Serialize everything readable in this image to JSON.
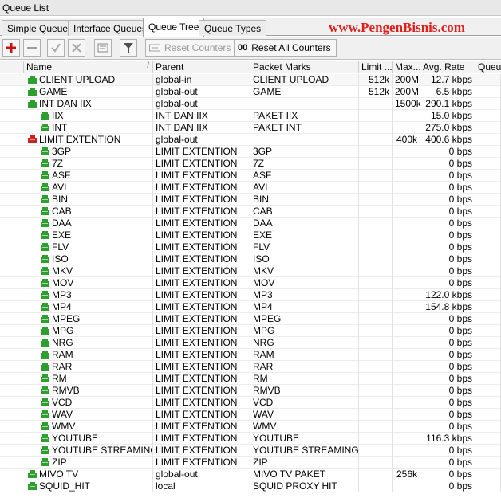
{
  "window": {
    "title": "Queue List"
  },
  "tabs": [
    {
      "label": "Simple Queues",
      "active": false
    },
    {
      "label": "Interface Queues",
      "active": false
    },
    {
      "label": "Queue Tree",
      "active": true
    },
    {
      "label": "Queue Types",
      "active": false
    }
  ],
  "watermark": "www.PengenBisnis.com",
  "toolbar": {
    "reset_counters": "Reset Counters",
    "reset_all_prefix": "00",
    "reset_all_counters": "Reset All Counters"
  },
  "columns": {
    "name": "Name",
    "parent": "Parent",
    "packet_marks": "Packet Marks",
    "limit_at": "Limit ...",
    "max_limit": "Max...",
    "avg_rate": "Avg. Rate",
    "queued": "Queue"
  },
  "colors": {
    "enabled_icon": "#2e9e2e",
    "disabled_icon": "#d02020",
    "brand": "#e0201c"
  },
  "rows": [
    {
      "indent": 0,
      "status": "green",
      "name": "CLIENT UPLOAD",
      "parent": "global-in",
      "packet_marks": "CLIENT UPLOAD",
      "limit_at": "512k",
      "max_limit": "200M",
      "avg_rate": "12.7 kbps"
    },
    {
      "indent": 0,
      "status": "green",
      "name": "GAME",
      "parent": "global-out",
      "packet_marks": "GAME",
      "limit_at": "512k",
      "max_limit": "200M",
      "avg_rate": "6.5 kbps"
    },
    {
      "indent": 0,
      "status": "green",
      "name": "INT DAN IIX",
      "parent": "global-out",
      "packet_marks": "",
      "limit_at": "",
      "max_limit": "1500k",
      "avg_rate": "290.1 kbps"
    },
    {
      "indent": 1,
      "status": "green",
      "name": "IIX",
      "parent": "INT DAN IIX",
      "packet_marks": "PAKET IIX",
      "limit_at": "",
      "max_limit": "",
      "avg_rate": "15.0 kbps"
    },
    {
      "indent": 1,
      "status": "green",
      "name": "INT",
      "parent": "INT DAN IIX",
      "packet_marks": "PAKET INT",
      "limit_at": "",
      "max_limit": "",
      "avg_rate": "275.0 kbps"
    },
    {
      "indent": 0,
      "status": "red",
      "name": "LIMIT EXTENTION",
      "parent": "global-out",
      "packet_marks": "",
      "limit_at": "",
      "max_limit": "400k",
      "avg_rate": "400.6 kbps"
    },
    {
      "indent": 1,
      "status": "green",
      "name": "3GP",
      "parent": "LIMIT EXTENTION",
      "packet_marks": "3GP",
      "limit_at": "",
      "max_limit": "",
      "avg_rate": "0 bps"
    },
    {
      "indent": 1,
      "status": "green",
      "name": "7Z",
      "parent": "LIMIT EXTENTION",
      "packet_marks": "7Z",
      "limit_at": "",
      "max_limit": "",
      "avg_rate": "0 bps"
    },
    {
      "indent": 1,
      "status": "green",
      "name": "ASF",
      "parent": "LIMIT EXTENTION",
      "packet_marks": "ASF",
      "limit_at": "",
      "max_limit": "",
      "avg_rate": "0 bps"
    },
    {
      "indent": 1,
      "status": "green",
      "name": "AVI",
      "parent": "LIMIT EXTENTION",
      "packet_marks": "AVI",
      "limit_at": "",
      "max_limit": "",
      "avg_rate": "0 bps"
    },
    {
      "indent": 1,
      "status": "green",
      "name": "BIN",
      "parent": "LIMIT EXTENTION",
      "packet_marks": "BIN",
      "limit_at": "",
      "max_limit": "",
      "avg_rate": "0 bps"
    },
    {
      "indent": 1,
      "status": "green",
      "name": "CAB",
      "parent": "LIMIT EXTENTION",
      "packet_marks": "CAB",
      "limit_at": "",
      "max_limit": "",
      "avg_rate": "0 bps"
    },
    {
      "indent": 1,
      "status": "green",
      "name": "DAA",
      "parent": "LIMIT EXTENTION",
      "packet_marks": "DAA",
      "limit_at": "",
      "max_limit": "",
      "avg_rate": "0 bps"
    },
    {
      "indent": 1,
      "status": "green",
      "name": "EXE",
      "parent": "LIMIT EXTENTION",
      "packet_marks": "EXE",
      "limit_at": "",
      "max_limit": "",
      "avg_rate": "0 bps"
    },
    {
      "indent": 1,
      "status": "green",
      "name": "FLV",
      "parent": "LIMIT EXTENTION",
      "packet_marks": "FLV",
      "limit_at": "",
      "max_limit": "",
      "avg_rate": "0 bps"
    },
    {
      "indent": 1,
      "status": "green",
      "name": "ISO",
      "parent": "LIMIT EXTENTION",
      "packet_marks": "ISO",
      "limit_at": "",
      "max_limit": "",
      "avg_rate": "0 bps"
    },
    {
      "indent": 1,
      "status": "green",
      "name": "MKV",
      "parent": "LIMIT EXTENTION",
      "packet_marks": "MKV",
      "limit_at": "",
      "max_limit": "",
      "avg_rate": "0 bps"
    },
    {
      "indent": 1,
      "status": "green",
      "name": "MOV",
      "parent": "LIMIT EXTENTION",
      "packet_marks": "MOV",
      "limit_at": "",
      "max_limit": "",
      "avg_rate": "0 bps"
    },
    {
      "indent": 1,
      "status": "green",
      "name": "MP3",
      "parent": "LIMIT EXTENTION",
      "packet_marks": "MP3",
      "limit_at": "",
      "max_limit": "",
      "avg_rate": "122.0 kbps"
    },
    {
      "indent": 1,
      "status": "green",
      "name": "MP4",
      "parent": "LIMIT EXTENTION",
      "packet_marks": "MP4",
      "limit_at": "",
      "max_limit": "",
      "avg_rate": "154.8 kbps"
    },
    {
      "indent": 1,
      "status": "green",
      "name": "MPEG",
      "parent": "LIMIT EXTENTION",
      "packet_marks": "MPEG",
      "limit_at": "",
      "max_limit": "",
      "avg_rate": "0 bps"
    },
    {
      "indent": 1,
      "status": "green",
      "name": "MPG",
      "parent": "LIMIT EXTENTION",
      "packet_marks": "MPG",
      "limit_at": "",
      "max_limit": "",
      "avg_rate": "0 bps"
    },
    {
      "indent": 1,
      "status": "green",
      "name": "NRG",
      "parent": "LIMIT EXTENTION",
      "packet_marks": "NRG",
      "limit_at": "",
      "max_limit": "",
      "avg_rate": "0 bps"
    },
    {
      "indent": 1,
      "status": "green",
      "name": "RAM",
      "parent": "LIMIT EXTENTION",
      "packet_marks": "RAM",
      "limit_at": "",
      "max_limit": "",
      "avg_rate": "0 bps"
    },
    {
      "indent": 1,
      "status": "green",
      "name": "RAR",
      "parent": "LIMIT EXTENTION",
      "packet_marks": "RAR",
      "limit_at": "",
      "max_limit": "",
      "avg_rate": "0 bps"
    },
    {
      "indent": 1,
      "status": "green",
      "name": "RM",
      "parent": "LIMIT EXTENTION",
      "packet_marks": "RM",
      "limit_at": "",
      "max_limit": "",
      "avg_rate": "0 bps"
    },
    {
      "indent": 1,
      "status": "green",
      "name": "RMVB",
      "parent": "LIMIT EXTENTION",
      "packet_marks": "RMVB",
      "limit_at": "",
      "max_limit": "",
      "avg_rate": "0 bps"
    },
    {
      "indent": 1,
      "status": "green",
      "name": "VCD",
      "parent": "LIMIT EXTENTION",
      "packet_marks": "VCD",
      "limit_at": "",
      "max_limit": "",
      "avg_rate": "0 bps"
    },
    {
      "indent": 1,
      "status": "green",
      "name": "WAV",
      "parent": "LIMIT EXTENTION",
      "packet_marks": "WAV",
      "limit_at": "",
      "max_limit": "",
      "avg_rate": "0 bps"
    },
    {
      "indent": 1,
      "status": "green",
      "name": "WMV",
      "parent": "LIMIT EXTENTION",
      "packet_marks": "WMV",
      "limit_at": "",
      "max_limit": "",
      "avg_rate": "0 bps"
    },
    {
      "indent": 1,
      "status": "green",
      "name": "YOUTUBE",
      "parent": "LIMIT EXTENTION",
      "packet_marks": "YOUTUBE",
      "limit_at": "",
      "max_limit": "",
      "avg_rate": "116.3 kbps"
    },
    {
      "indent": 1,
      "status": "green",
      "name": "YOUTUBE STREAMING",
      "parent": "LIMIT EXTENTION",
      "packet_marks": "YOUTUBE STREAMING",
      "limit_at": "",
      "max_limit": "",
      "avg_rate": "0 bps"
    },
    {
      "indent": 1,
      "status": "green",
      "name": "ZIP",
      "parent": "LIMIT EXTENTION",
      "packet_marks": "ZIP",
      "limit_at": "",
      "max_limit": "",
      "avg_rate": "0 bps"
    },
    {
      "indent": 0,
      "status": "green",
      "name": "MIVO TV",
      "parent": "global-out",
      "packet_marks": "MIVO TV PAKET",
      "limit_at": "",
      "max_limit": "256k",
      "avg_rate": "0 bps"
    },
    {
      "indent": 0,
      "status": "green",
      "name": "SQUID_HIT",
      "parent": "local",
      "packet_marks": "SQUID PROXY HIT",
      "limit_at": "",
      "max_limit": "",
      "avg_rate": "0 bps"
    }
  ]
}
